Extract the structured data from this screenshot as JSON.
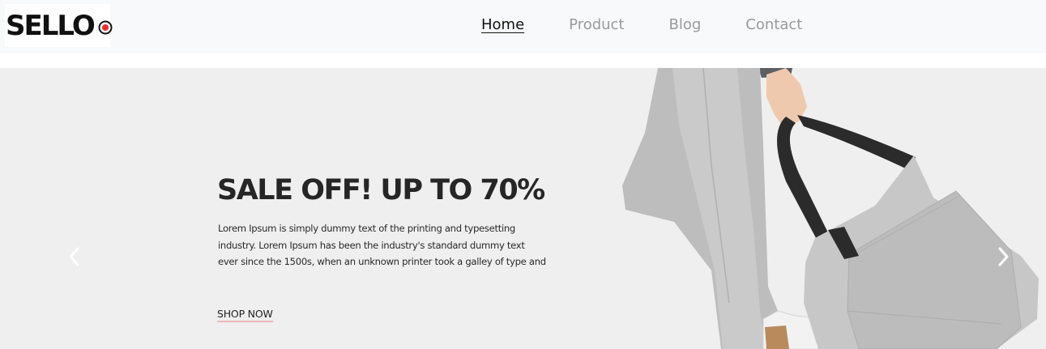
{
  "brand": {
    "logo_text": "SELLO",
    "accent_color": "#e8312c"
  },
  "nav": {
    "items": [
      {
        "label": "Home",
        "active": true
      },
      {
        "label": "Product",
        "active": false
      },
      {
        "label": "Blog",
        "active": false
      },
      {
        "label": "Contact",
        "active": false
      }
    ]
  },
  "hero": {
    "title": "SALE OFF! UP TO 70%",
    "text_lines": [
      "Lorem Ipsum is simply dummy text of the printing and typesetting",
      "industry. Lorem Ipsum has been the industry's standard dummy text",
      "ever since the 1500s, when an unknown printer took a galley of type and"
    ],
    "cta_label": "SHOP NOW",
    "prev_icon": "chevron-left-icon",
    "next_icon": "chevron-right-icon",
    "image": "model-with-grey-tote-bag"
  }
}
